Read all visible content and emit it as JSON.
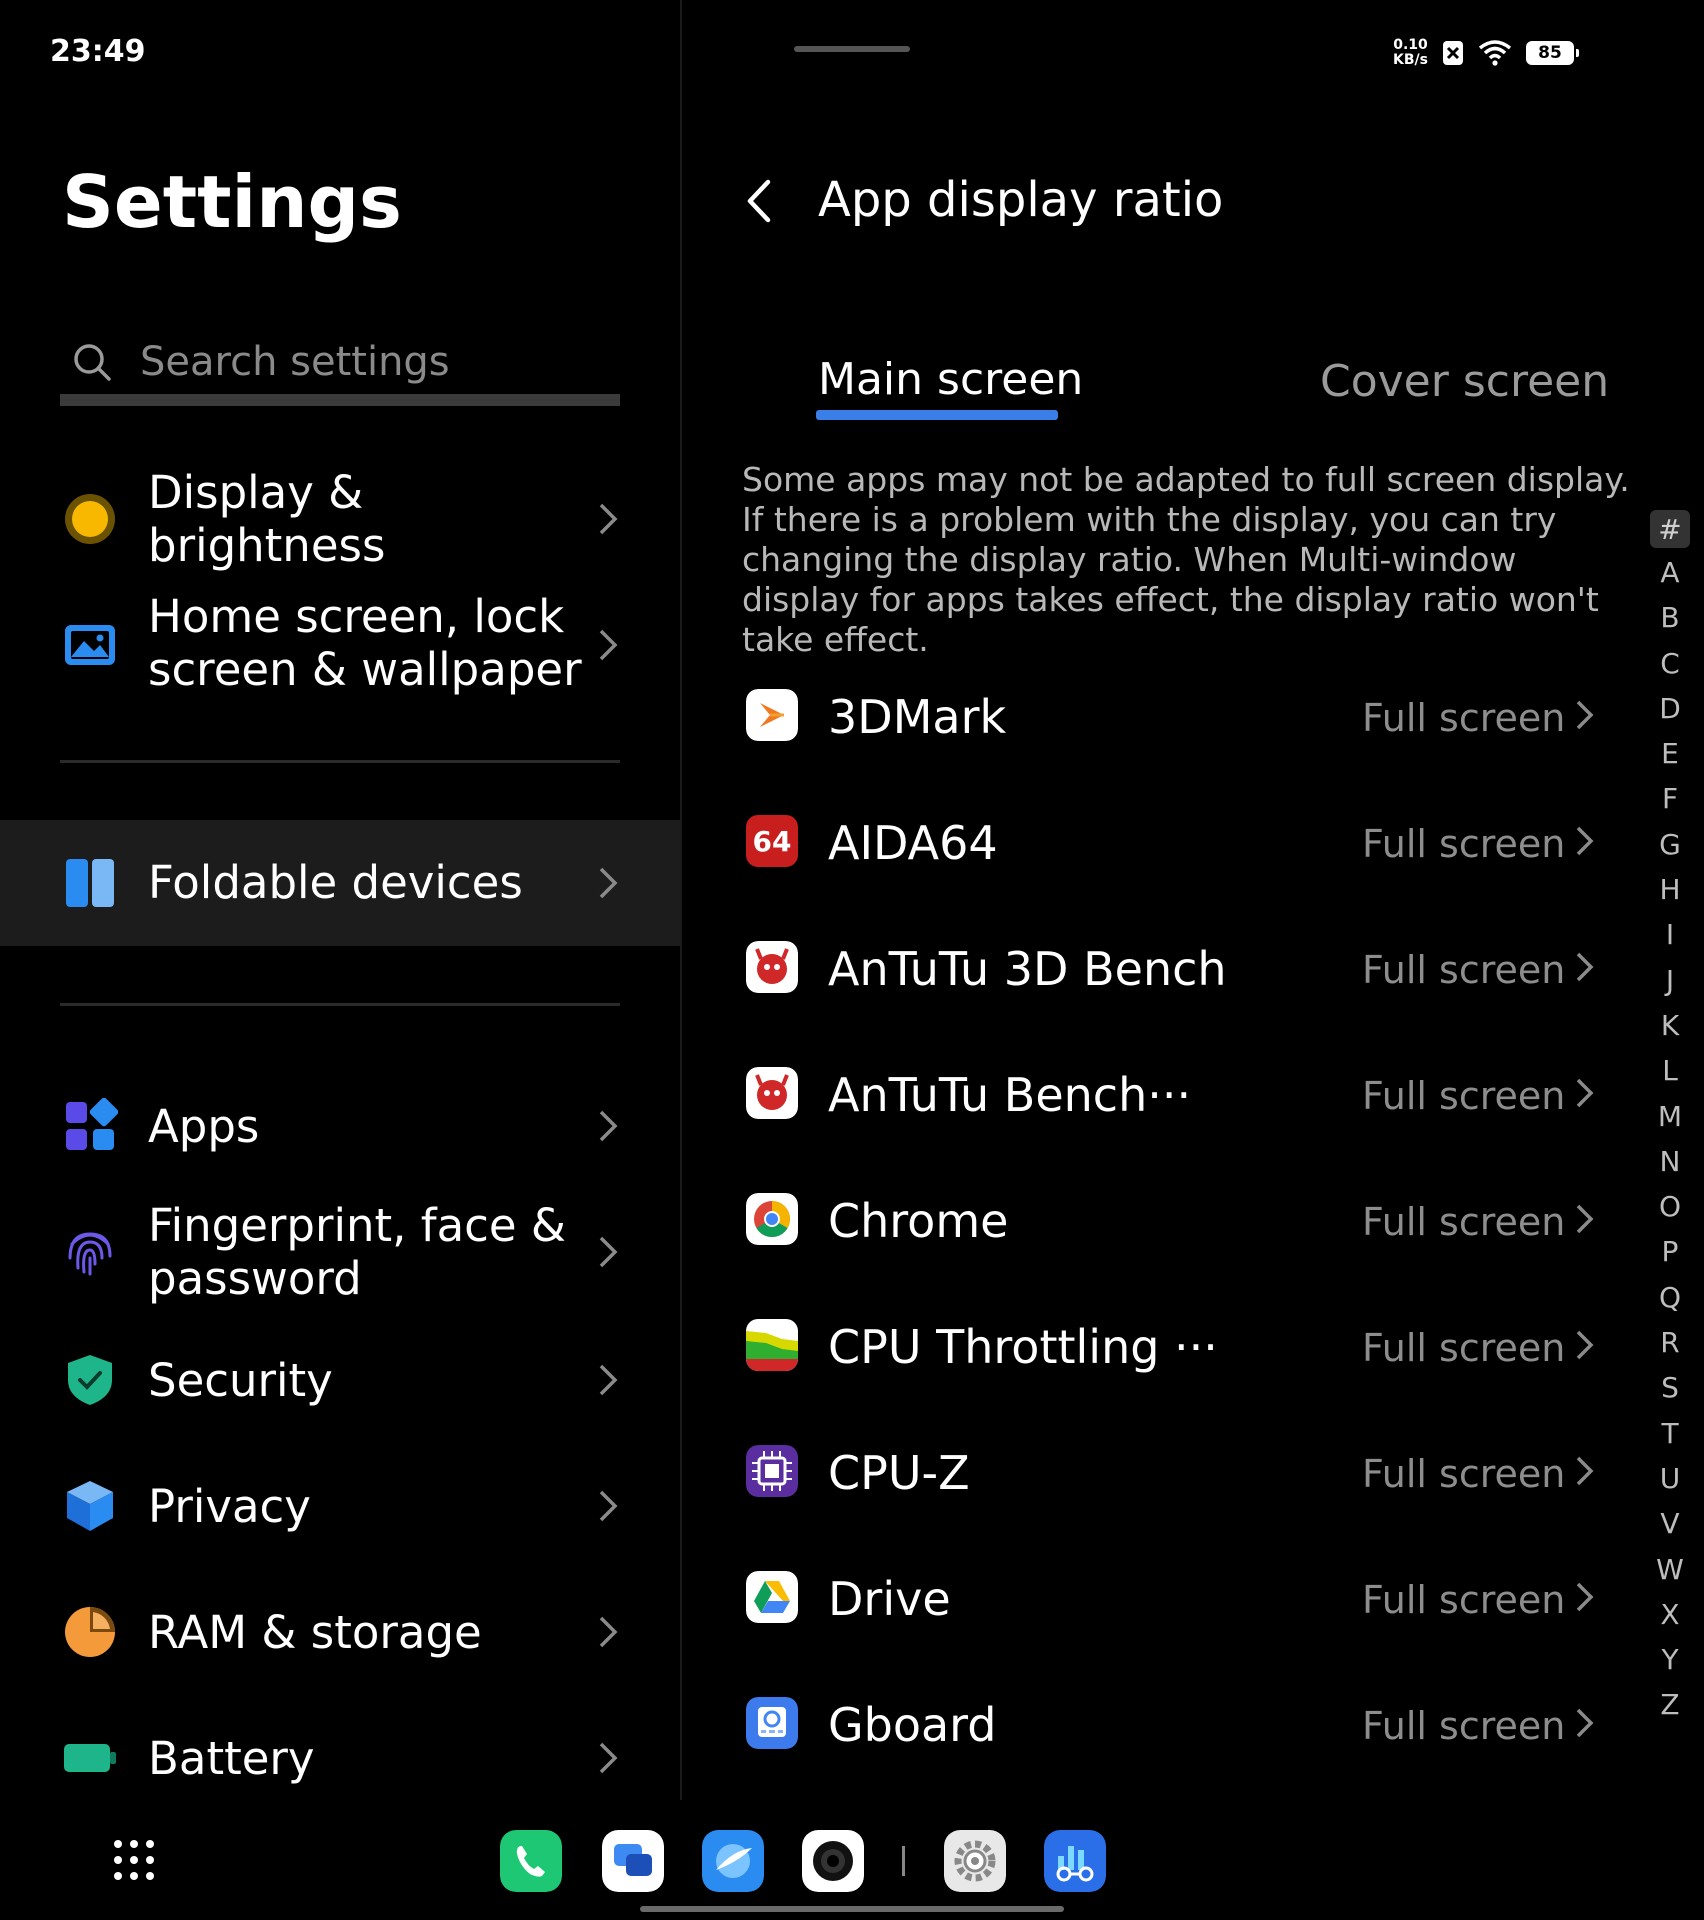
{
  "status_bar": {
    "time": "23:49",
    "net_speed_value": "0.10",
    "net_speed_unit": "KB/s",
    "battery": "85"
  },
  "left": {
    "title": "Settings",
    "search_placeholder": "Search settings",
    "items": [
      {
        "label_line1": "Display &",
        "label_line2": "brightness",
        "icon": "sun-icon"
      },
      {
        "label_line1": "Home screen, lock",
        "label_line2": "screen & wallpaper",
        "icon": "wallpaper-icon"
      },
      {
        "label_line1": "Foldable devices",
        "icon": "foldable-icon"
      },
      {
        "label_line1": "Apps",
        "icon": "apps-icon"
      },
      {
        "label_line1": "Fingerprint, face &",
        "label_line2": "password",
        "icon": "fingerprint-icon"
      },
      {
        "label_line1": "Security",
        "icon": "shield-icon"
      },
      {
        "label_line1": "Privacy",
        "icon": "privacy-icon"
      },
      {
        "label_line1": "RAM & storage",
        "icon": "storage-pie-icon"
      },
      {
        "label_line1": "Battery",
        "icon": "battery-icon"
      }
    ]
  },
  "right": {
    "title": "App display ratio",
    "tabs": [
      "Main screen",
      "Cover screen"
    ],
    "description": "Some apps may not be adapted to full screen display. If there is a problem with the display, you can try changing the display ratio. When Multi-window display for apps takes effect, the display ratio won't take effect.",
    "apps": [
      {
        "name": "3DMark",
        "value": "Full screen"
      },
      {
        "name": "AIDA64",
        "value": "Full screen"
      },
      {
        "name": "AnTuTu 3D Bench",
        "value": "Full screen"
      },
      {
        "name": "AnTuTu Bench···",
        "value": "Full screen"
      },
      {
        "name": "Chrome",
        "value": "Full screen"
      },
      {
        "name": "CPU Throttling ···",
        "value": "Full screen"
      },
      {
        "name": "CPU-Z",
        "value": "Full screen"
      },
      {
        "name": "Drive",
        "value": "Full screen"
      },
      {
        "name": "Gboard",
        "value": "Full screen"
      }
    ],
    "alpha_index": [
      "#",
      "A",
      "B",
      "C",
      "D",
      "E",
      "F",
      "G",
      "H",
      "I",
      "J",
      "K",
      "L",
      "M",
      "N",
      "O",
      "P",
      "Q",
      "R",
      "S",
      "T",
      "U",
      "V",
      "W",
      "X",
      "Y",
      "Z"
    ]
  },
  "icons": {
    "aida64_badge": "64"
  },
  "dock": [
    "phone-icon",
    "messages-icon",
    "browser-icon",
    "camera-icon",
    "settings-gear-icon",
    "benchmark-icon"
  ]
}
